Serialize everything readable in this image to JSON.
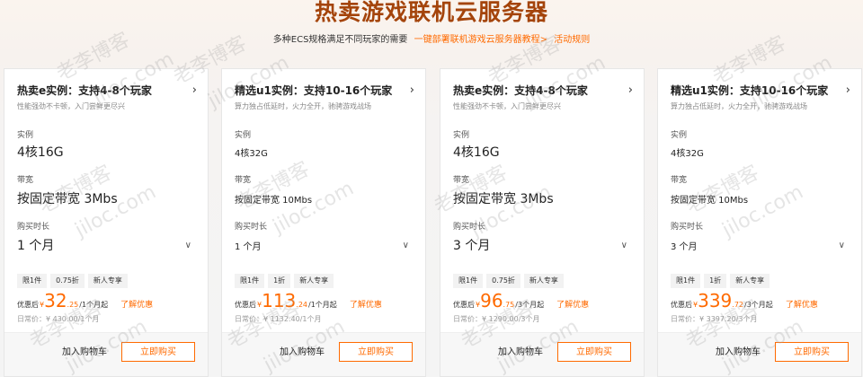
{
  "page": {
    "title": "热卖游戏联机云服务器",
    "subtitle_text": "多种ECS规格满足不同玩家的需要",
    "tutorial_link": "一键部署联机游戏云服务器教程>",
    "rules_link": "活动规则"
  },
  "labels": {
    "instance": "实例",
    "bandwidth": "带宽",
    "duration": "购买时长",
    "discount_price": "优惠后",
    "currency": "¥",
    "learn_more": "了解优惠",
    "add_to_cart": "加入购物车",
    "buy_now": "立即购买"
  },
  "cards": [
    {
      "title": "热卖e实例：支持4-8个玩家",
      "desc": "性能强劲不卡顿，入门尝鲜更尽兴",
      "instance": "4核16G",
      "bandwidth": "按固定带宽 3Mbs",
      "duration": "1 个月",
      "tags": [
        "限1件",
        "0.75折",
        "新人专享"
      ],
      "price_int": "32",
      "price_dec": ".25",
      "price_unit": "/1个月起",
      "regular": "日常价：¥ 430.00/1个月"
    },
    {
      "title": "精选u1实例：支持10-16个玩家",
      "desc": "算力独占低延时，火力全开，驰骋游戏战场",
      "instance": "4核32G",
      "bandwidth": "按固定带宽 10Mbs",
      "duration": "1 个月",
      "tags": [
        "限1件",
        "1折",
        "新人专享"
      ],
      "price_int": "113",
      "price_dec": ".24",
      "price_unit": "/1个月起",
      "regular": "日常价：¥ 1132.40/1个月"
    },
    {
      "title": "热卖e实例：支持4-8个玩家",
      "desc": "性能强劲不卡顿，入门尝鲜更尽兴",
      "instance": "4核16G",
      "bandwidth": "按固定带宽 3Mbs",
      "duration": "3 个月",
      "tags": [
        "限1件",
        "0.75折",
        "新人专享"
      ],
      "price_int": "96",
      "price_dec": ".75",
      "price_unit": "/3个月起",
      "regular": "日常价：¥ 1290.00/3个月"
    },
    {
      "title": "精选u1实例：支持10-16个玩家",
      "desc": "算力独占低延时，火力全开，驰骋游戏战场",
      "instance": "4核32G",
      "bandwidth": "按固定带宽 10Mbs",
      "duration": "3 个月",
      "tags": [
        "限1件",
        "1折",
        "新人专享"
      ],
      "price_int": "339",
      "price_dec": ".72",
      "price_unit": "/3个月起",
      "regular": "日常价：¥ 3397.20/3个月"
    }
  ],
  "watermark": {
    "line1": "老李博客",
    "line2": "jiloc.com"
  }
}
